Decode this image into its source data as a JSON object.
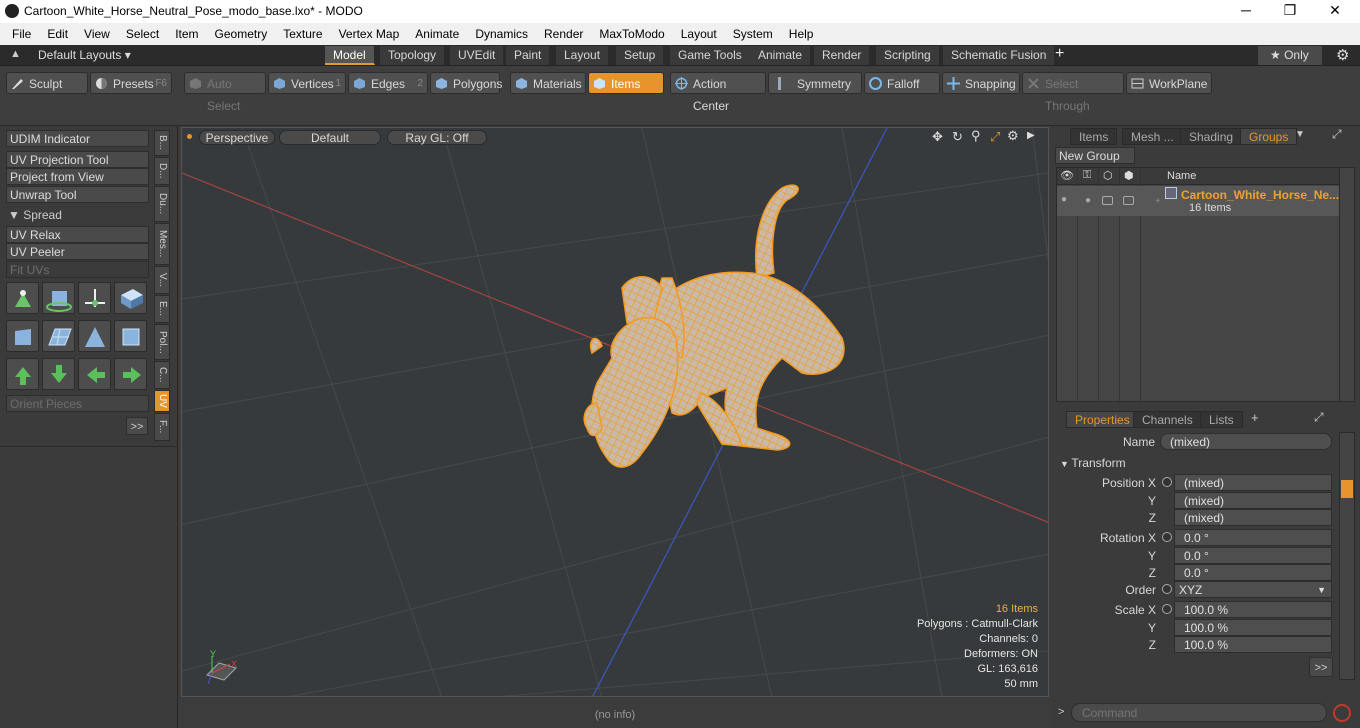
{
  "window": {
    "title": "Cartoon_White_Horse_Neutral_Pose_modo_base.lxo* - MODO",
    "minimize": "─",
    "maximize": "❐",
    "close": "✕"
  },
  "menu": [
    "File",
    "Edit",
    "View",
    "Select",
    "Item",
    "Geometry",
    "Texture",
    "Vertex Map",
    "Animate",
    "Dynamics",
    "Render",
    "MaxToModo",
    "Layout",
    "System",
    "Help"
  ],
  "layout_tabs": {
    "layouts_label": "Default Layouts ▾",
    "tabs": [
      "Model",
      "Topology",
      "UVEdit",
      "Paint",
      "Layout",
      "Setup",
      "Game Tools",
      "Animate",
      "Render",
      "Scripting",
      "Schematic Fusion"
    ],
    "add": "+",
    "only": "★  Only",
    "gear": "⚙"
  },
  "toolbar": {
    "sculpt": "Sculpt",
    "presets": "Presets",
    "presets_key": "F6",
    "auto_select": "Auto Select",
    "vertices": "Vertices",
    "vertices_n": "1",
    "edges": "Edges",
    "edges_n": "2",
    "polygons": "Polygons",
    "materials": "Materials",
    "items": "Items",
    "action_center": "Action Center",
    "symmetry": "Symmetry",
    "falloff": "Falloff",
    "snapping": "Snapping",
    "select_through": "Select Through",
    "workplane": "WorkPlane"
  },
  "left": {
    "buttons": [
      "UDIM Indicator",
      "UV Projection Tool",
      "Project from View",
      "Unwrap Tool"
    ],
    "spread": "▼ Spread",
    "buttons2": [
      "UV Relax",
      "UV Peeler"
    ],
    "fit_uvs": "Fit UVs",
    "orient": "Orient Pieces",
    "more": ">>",
    "vtabs": [
      "B...",
      "D...",
      "Du...",
      "Mes...",
      "V...",
      "E...",
      "Pol...",
      "C...",
      "UV",
      "F..."
    ]
  },
  "viewport": {
    "view": "Perspective",
    "shading": "Default",
    "raygl": "Ray GL: Off",
    "info_items": "16 Items",
    "info_polygons": "Polygons : Catmull-Clark",
    "info_channels": "Channels: 0",
    "info_deformers": "Deformers: ON",
    "info_gl": "GL: 163,616",
    "info_mm": "50 mm",
    "axis_y": "Y",
    "axis_x": "X"
  },
  "status": "(no info)",
  "groups": {
    "tabs": [
      "Items",
      "Mesh ...",
      "Shading",
      "Groups"
    ],
    "new_group": "New Group",
    "col_name": "Name",
    "item_name": "Cartoon_White_Horse_Ne...",
    "item_count": "16 Items"
  },
  "properties": {
    "tabs": [
      "Properties",
      "Channels",
      "Lists"
    ],
    "name_label": "Name",
    "name_value": "(mixed)",
    "transform": "Transform",
    "position_x_label": "Position X",
    "position_x": "(mixed)",
    "position_y": "(mixed)",
    "position_z": "(mixed)",
    "rotation_x_label": "Rotation X",
    "rotation_x": "0.0 °",
    "rotation_y": "0.0 °",
    "rotation_z": "0.0 °",
    "order_label": "Order",
    "order_value": "XYZ",
    "scale_x_label": "Scale X",
    "scale_x": "100.0 %",
    "scale_y": "100.0 %",
    "scale_z": "100.0 %",
    "y": "Y",
    "z": "Z",
    "more": ">>"
  },
  "command": {
    "prompt": ">",
    "placeholder": "Command"
  }
}
